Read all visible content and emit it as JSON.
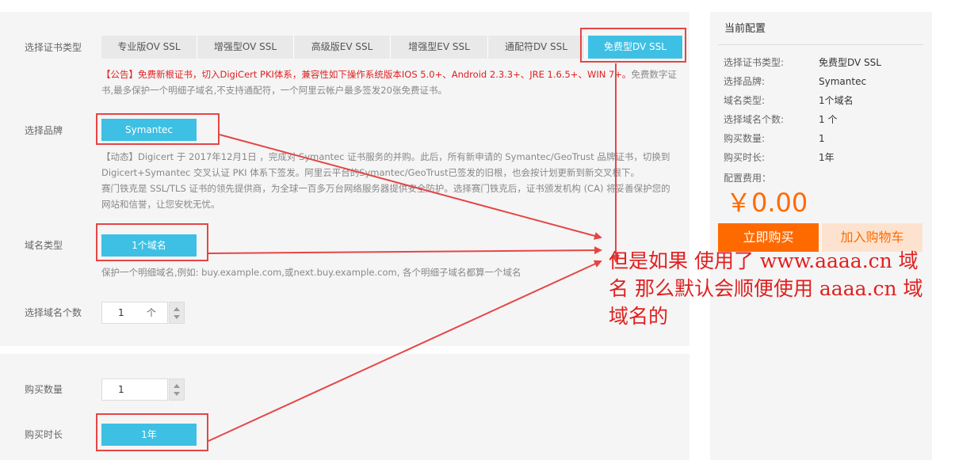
{
  "config": {
    "cert_type_label": "选择证书类型",
    "cert_tabs": [
      "专业版OV SSL",
      "增强型OV SSL",
      "高级版EV SSL",
      "增强型EV SSL",
      "通配符DV SSL",
      "免费型DV SSL"
    ],
    "active_tab": "免费型DV SSL",
    "notice_red": "【公告】免费新根证书，切入DigiCert PKI体系，兼容性如下操作系统版本IOS 5.0+、Android 2.3.3+、JRE 1.6.5+、WIN 7+。",
    "notice_rest": "免费数字证书,最多保护一个明细子域名,不支持通配符，一个阿里云帐户最多签发20张免费证书。",
    "brand_label": "选择品牌",
    "brand_value": "Symantec",
    "brand_note_1": "【动态】Digicert 于 2017年12月1日 ，完成对 Symantec 证书服务的并购。此后，所有新申请的 Symantec/GeoTrust 品牌证书，切换到Digicert+Symantec 交叉认证 PKI 体系下签发。阿里云平台的Symantec/GeoTrust已签发的旧根，也会按计划更新到新交叉根下。",
    "brand_note_2": "赛门铁克是 SSL/TLS 证书的领先提供商，为全球一百多万台网络服务器提供安全防护。选择赛门铁克后，证书颁发机构 (CA) 将妥善保护您的网站和信誉，让您安枕无忧。",
    "domain_type_label": "域名类型",
    "domain_type_value": "1个域名",
    "domain_type_note": "保护一个明细域名,例如: buy.example.com,或next.buy.example.com, 各个明细子域名都算一个域名",
    "domain_count_label": "选择域名个数",
    "domain_count_value": "1",
    "domain_count_unit": "个"
  },
  "purchase": {
    "qty_label": "购买数量",
    "qty_value": "1",
    "duration_label": "购买时长",
    "duration_value": "1年"
  },
  "sidebar": {
    "title": "当前配置",
    "rows": [
      {
        "label": "选择证书类型:",
        "value": "免费型DV SSL"
      },
      {
        "label": "选择品牌:",
        "value": "Symantec"
      },
      {
        "label": "域名类型:",
        "value": "1个域名"
      },
      {
        "label": "选择域名个数:",
        "value": "1 个"
      },
      {
        "label": "购买数量:",
        "value": "1"
      },
      {
        "label": "购买时长:",
        "value": "1年"
      }
    ],
    "fee_label": "配置费用：",
    "price": "￥0.00",
    "buy_now": "立即购买",
    "add_cart": "加入购物车"
  },
  "annotation": {
    "line1": "但是如果 使用了 www.aaaa.cn 域",
    "line2": "名 那么默认会顺便使用 aaaa.cn 域",
    "line3": "域名的"
  },
  "colors": {
    "accent": "#3ec0e4",
    "annotation_red": "#e64545",
    "buy_orange": "#ff6a00",
    "cart_bg": "#fde3cf",
    "price_orange": "#ff6a00"
  }
}
